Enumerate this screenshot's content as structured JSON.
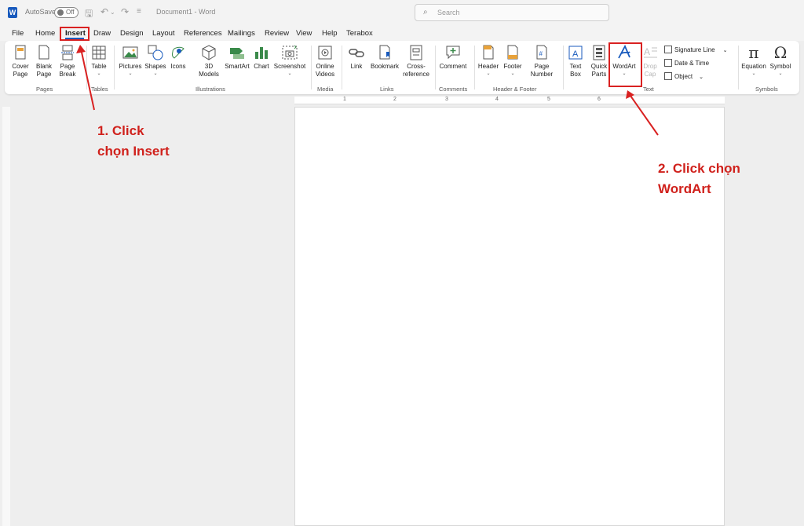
{
  "titlebar": {
    "autosave_label": "AutoSave",
    "autosave_state": "Off",
    "doc_title": "Document1 - Word",
    "search_placeholder": "Search"
  },
  "tabs": [
    "File",
    "Home",
    "Insert",
    "Draw",
    "Design",
    "Layout",
    "References",
    "Mailings",
    "Review",
    "View",
    "Help",
    "Terabox"
  ],
  "active_tab": "Insert",
  "ribbon": {
    "pages": {
      "cover_page": "Cover",
      "cover_page_2": "Page",
      "blank_page": "Blank",
      "blank_page_2": "Page",
      "page_break": "Page",
      "page_break_2": "Break",
      "group": "Pages"
    },
    "tables": {
      "table": "Table",
      "group": "Tables"
    },
    "illustrations": {
      "pictures": "Pictures",
      "shapes": "Shapes",
      "icons": "Icons",
      "models": "3D",
      "models_2": "Models",
      "smartart": "SmartArt",
      "chart": "Chart",
      "screenshot": "Screenshot",
      "group": "Illustrations"
    },
    "media": {
      "online": "Online",
      "videos": "Videos",
      "group": "Media"
    },
    "links": {
      "link": "Link",
      "bookmark": "Bookmark",
      "cross": "Cross-",
      "reference": "reference",
      "group": "Links"
    },
    "comments": {
      "comment": "Comment",
      "group": "Comments"
    },
    "header_footer": {
      "header": "Header",
      "footer": "Footer",
      "page_number": "Page",
      "page_number_2": "Number",
      "group": "Header & Footer"
    },
    "text": {
      "text_box": "Text",
      "text_box_2": "Box",
      "quick_parts": "Quick",
      "quick_parts_2": "Parts",
      "wordart": "WordArt",
      "drop_cap": "Drop",
      "drop_cap_2": "Cap",
      "signature_line": "Signature Line",
      "date_time": "Date & Time",
      "object": "Object",
      "group": "Text"
    },
    "symbols": {
      "equation": "Equation",
      "symbol": "Symbol",
      "group": "Symbols"
    }
  },
  "ruler": {
    "numbers": [
      "1",
      "2",
      "3",
      "4",
      "5",
      "6"
    ]
  },
  "annotations": {
    "step1": "1. Click\nchọn Insert",
    "step2": "2. Click chọn\nWordArt",
    "color": "#d0211c"
  },
  "colors": {
    "accent": "#185abd",
    "annotation": "#d92121"
  }
}
